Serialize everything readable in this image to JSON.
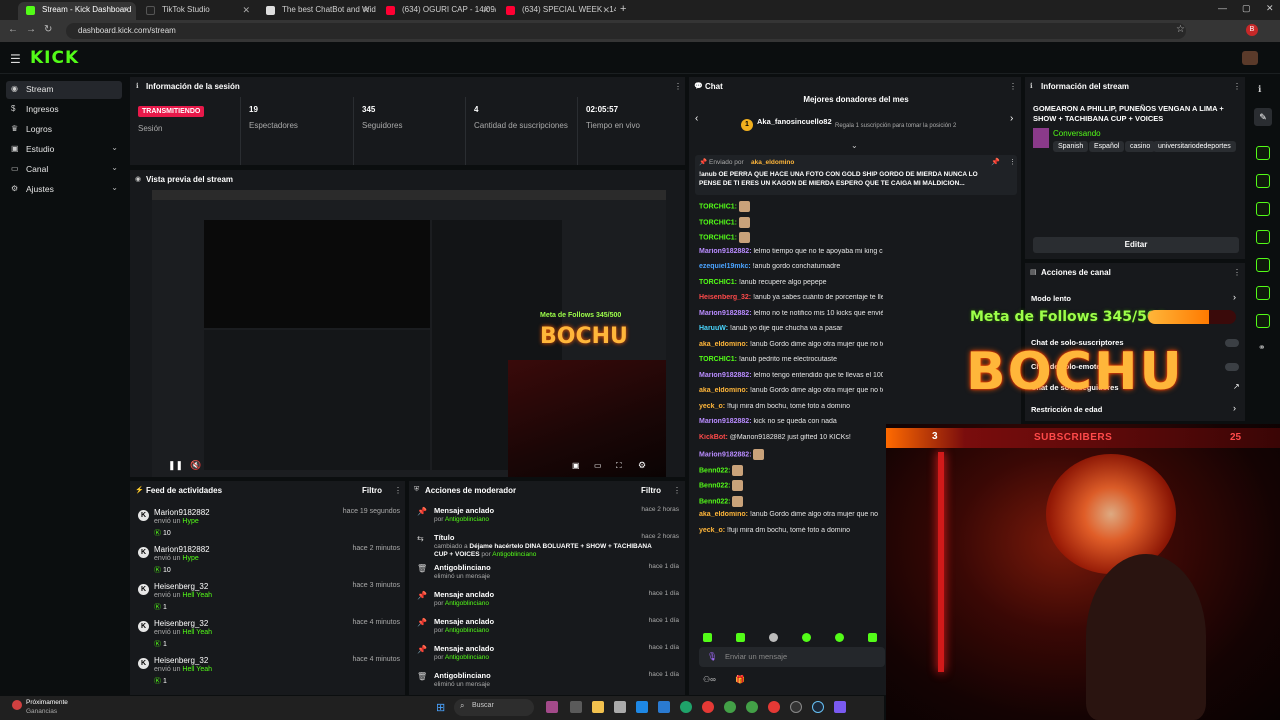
{
  "browser": {
    "tabs": [
      {
        "label": "Stream - Kick Dashboard",
        "active": true,
        "fav_color": "#53fc18"
      },
      {
        "label": "TikTok Studio",
        "active": false,
        "fav_color": "#222222"
      },
      {
        "label": "The best ChatBot and Widget...",
        "active": false,
        "fav_color": "#dddddd"
      },
      {
        "label": "(634) OGURI CAP - 14/09/2025",
        "active": false,
        "fav_color": "#ff0033"
      },
      {
        "label": "(634) SPECIAL WEEK - 14/09/2...",
        "active": false,
        "fav_color": "#ff0033"
      }
    ],
    "url": "dashboard.kick.com/stream",
    "profile_initial": "B"
  },
  "logo": "KICK",
  "sidebar": {
    "items": [
      {
        "label": "Stream",
        "icon": "broadcast-icon",
        "active": true,
        "chevron": false
      },
      {
        "label": "Ingresos",
        "icon": "money-icon",
        "active": false,
        "chevron": false
      },
      {
        "label": "Logros",
        "icon": "trophy-icon",
        "active": false,
        "chevron": false
      },
      {
        "label": "Estudio",
        "icon": "studio-icon",
        "active": false,
        "chevron": true
      },
      {
        "label": "Canal",
        "icon": "channel-icon",
        "active": false,
        "chevron": true
      },
      {
        "label": "Ajustes",
        "icon": "gear-icon",
        "active": false,
        "chevron": true
      }
    ]
  },
  "session": {
    "title": "Información de la sesión",
    "status_badge": "TRANSMITIENDO",
    "status_label": "Sesión",
    "stats": [
      {
        "value": "19",
        "label": "Espectadores"
      },
      {
        "value": "345",
        "label": "Seguidores"
      },
      {
        "value": "4",
        "label": "Cantidad de suscripciones"
      },
      {
        "value": "02:05:57",
        "label": "Tiempo en vivo"
      }
    ]
  },
  "preview": {
    "title": "Vista previa del stream"
  },
  "activity": {
    "title": "Feed de actividades",
    "filter": "Filtro",
    "items": [
      {
        "name": "Marion9182882",
        "action": "envió un",
        "item": "Hype",
        "count": "10",
        "time": "hace 19 segundos"
      },
      {
        "name": "Marion9182882",
        "action": "envió un",
        "item": "Hype",
        "count": "10",
        "time": "hace 2 minutos"
      },
      {
        "name": "Heisenberg_32",
        "action": "envió un",
        "item": "Hell Yeah",
        "count": "1",
        "time": "hace 3 minutos"
      },
      {
        "name": "Heisenberg_32",
        "action": "envió un",
        "item": "Hell Yeah",
        "count": "1",
        "time": "hace 4 minutos"
      },
      {
        "name": "Heisenberg_32",
        "action": "envió un",
        "item": "Hell Yeah",
        "count": "1",
        "time": "hace 4 minutos"
      }
    ]
  },
  "moderation": {
    "title": "Acciones de moderador",
    "filter": "Filtro",
    "items": [
      {
        "icon": "pin-icon",
        "action": "Mensaje anclado",
        "detail": "por",
        "by": "Antigoblinciano",
        "time": "hace 2 horas"
      },
      {
        "icon": "title-icon",
        "action": "Título",
        "detail": "cambiado a",
        "extra": "Déjame hacértelo DINA BOLUARTE + SHOW + TACHIBANA CUP + VOICES",
        "by": "Antigoblinciano",
        "time": "hace 2 horas"
      },
      {
        "icon": "trash-icon",
        "action": "Antigoblinciano",
        "detail": "eliminó un mensaje",
        "by": "",
        "time": "hace 1 día"
      },
      {
        "icon": "pin-icon",
        "action": "Mensaje anclado",
        "detail": "por",
        "by": "Antigoblinciano",
        "time": "hace 1 día"
      },
      {
        "icon": "pin-icon",
        "action": "Mensaje anclado",
        "detail": "por",
        "by": "Antigoblinciano",
        "time": "hace 1 día"
      },
      {
        "icon": "pin-icon",
        "action": "Mensaje anclado",
        "detail": "por",
        "by": "Antigoblinciano",
        "time": "hace 1 día"
      },
      {
        "icon": "trash-icon",
        "action": "Antigoblinciano",
        "detail": "eliminó un mensaje",
        "by": "",
        "time": "hace 1 día"
      }
    ]
  },
  "chat": {
    "title": "Chat",
    "top_donors_title": "Mejores donadores del mes",
    "top_donor": "Aka_fanosincuello82",
    "top_donor_rank": "1",
    "top_donor_hint": "Regala 1 suscripción para tomar la posición 2",
    "pinned_by_label": "Enviado por",
    "pinned_by": "aka_eldomino",
    "pinned_text": "!anub OE PERRA QUE HACE UNA FOTO CON GOLD SHIP GORDO DE MIERDA NUNCA LO PENSE DE TI ERES UN KAGON DE MIERDA ESPERO QUE TE CAIGA MI MALDICION...",
    "messages": [
      {
        "user": "TORCHIC1:",
        "color": "#53fc18",
        "text": "[emote]"
      },
      {
        "user": "TORCHIC1:",
        "color": "#53fc18",
        "text": "[emote]"
      },
      {
        "user": "TORCHIC1:",
        "color": "#53fc18",
        "text": "[emote]"
      },
      {
        "user": "Marion9182882:",
        "color": "#b98cff",
        "text": "lelmo tiempo que no te apoyaba mi king cada vez que entre te daré 10 kicks"
      },
      {
        "user": "ezequiel19mkc:",
        "color": "#4aa3ff",
        "text": "!anub gordo conchatumadre"
      },
      {
        "user": "TORCHIC1:",
        "color": "#53fc18",
        "text": "!anub recupere algo pepepe"
      },
      {
        "user": "Heisenberg_32:",
        "color": "#ff4a4a",
        "text": "!anub ya sabes cuánto de porcentaje te llevas de los kiks?"
      },
      {
        "user": "Marion9182882:",
        "color": "#b98cff",
        "text": "lelmo no te notifico mis 10 kicks que envié ahorita ?"
      },
      {
        "user": "HaruuW:",
        "color": "#4ad7ff",
        "text": "!anub yo dije que chucha va a pasar"
      },
      {
        "user": "aka_eldomino:",
        "color": "#ffb63a",
        "text": "!anub Gordo dime algo otra mujer que no te coges nicagando?"
      },
      {
        "user": "TORCHIC1:",
        "color": "#53fc18",
        "text": "!anub pedrito me electrocutaste"
      },
      {
        "user": "Marion9182882:",
        "color": "#b98cff",
        "text": "lelmo tengo entendido que te llevas el 100% de las donaciones"
      },
      {
        "user": "aka_eldomino:",
        "color": "#ffb63a",
        "text": "!anub Gordo dime algo otra mujer que no te coges nicagando?"
      },
      {
        "user": "yeck_o:",
        "color": "#ffb63a",
        "text": "!fuji mira dm bochu, tomé foto a domino"
      },
      {
        "user": "Marion9182882:",
        "color": "#b98cff",
        "text": "kick no se queda con nada"
      },
      {
        "user": "KickBot:",
        "color": "#ff4a4a",
        "text": "@Marion9182882 just gifted 10 KICKs!"
      },
      {
        "user": "Marion9182882:",
        "color": "#b98cff",
        "text": "[emote]"
      },
      {
        "user": "Benn022:",
        "color": "#53fc18",
        "text": "[emote]"
      },
      {
        "user": "Benn022:",
        "color": "#53fc18",
        "text": "[emote]"
      },
      {
        "user": "Benn022:",
        "color": "#53fc18",
        "text": "[emote]"
      },
      {
        "user": "aka_eldomino:",
        "color": "#ffb63a",
        "text": "!anub Gordo dime algo otra mujer que no"
      },
      {
        "user": "yeck_o:",
        "color": "#ffb63a",
        "text": "!fuji mira dm bochu, tomé foto a domino"
      }
    ],
    "input_placeholder": "Enviar un mensaje"
  },
  "stream_info": {
    "title": "Información del stream",
    "stream_title": "GOMEARON A PHILLIP, PUNEÑOS VENGAN A LIMA + SHOW + TACHIBANA CUP + VOICES",
    "category": "Conversando",
    "tags": [
      "Spanish",
      "Español",
      "casino",
      "universitariodedeportes"
    ],
    "edit_label": "Editar"
  },
  "channel_actions": {
    "title": "Acciones de canal",
    "items": [
      {
        "label": "Modo lento",
        "kind": "chevron"
      },
      {
        "label": "Chat de solo-suscriptores",
        "kind": "toggle"
      },
      {
        "label": "Chat de solo-emotes",
        "kind": "toggle"
      },
      {
        "label": "Chat de solo-seguidores",
        "kind": "link"
      },
      {
        "label": "Restricción de edad",
        "kind": "chevron"
      }
    ]
  },
  "overlay": {
    "goal_text": "Meta de Follows 345/500",
    "goal_fraction": 0.69,
    "brand": "BOCHU",
    "subs_label": "SUBSCRIBERS",
    "subs_count": "25",
    "subs_rank": "3"
  },
  "taskbar": {
    "weather_line1": "Próximamente",
    "weather_line2": "Ganancias",
    "search_placeholder": "Buscar"
  }
}
